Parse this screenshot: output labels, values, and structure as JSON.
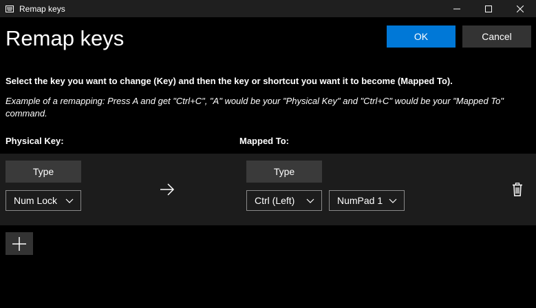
{
  "window": {
    "title": "Remap keys",
    "minimize_icon": "minimize-icon",
    "maximize_icon": "maximize-icon",
    "close_icon": "close-icon"
  },
  "header": {
    "title": "Remap keys",
    "ok_label": "OK",
    "cancel_label": "Cancel"
  },
  "instructions": "Select the key you want to change (Key) and then the key or shortcut you want it to become (Mapped To).",
  "example": "Example of a remapping: Press A and get \"Ctrl+C\", \"A\" would be your \"Physical Key\" and \"Ctrl+C\" would be your \"Mapped To\" command.",
  "columns": {
    "physical": "Physical Key:",
    "mapped": "Mapped To:"
  },
  "remap_row": {
    "physical_type_label": "Type",
    "physical_key": "Num Lock",
    "arrow_icon": "right-arrow-icon",
    "mapped_type_label": "Type",
    "mapped_keys": [
      "Ctrl (Left)",
      "NumPad 1"
    ],
    "delete_icon": "trash-icon"
  },
  "add_icon": "plus-icon",
  "colors": {
    "background": "#000000",
    "titlebar": "#1f1f1f",
    "accent": "#0078d7",
    "button": "#333333",
    "row": "#1c1c1c"
  }
}
